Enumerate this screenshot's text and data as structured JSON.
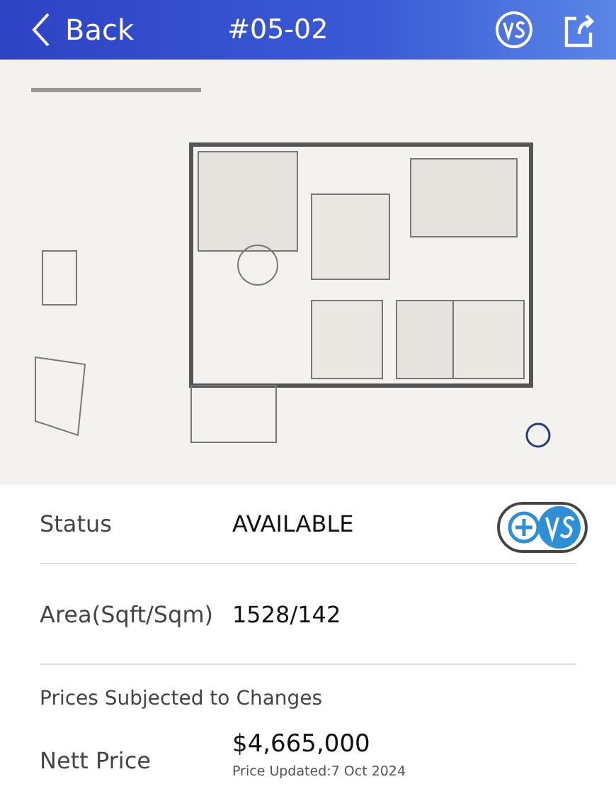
{
  "header": {
    "back": "Back",
    "title": "#05-02"
  },
  "details": [
    {
      "label": "Status",
      "value": "AVAILABLE"
    },
    {
      "label": "Area(Sqft/Sqm)",
      "value": "1528/142"
    }
  ],
  "note": "Prices Subjected to Changes",
  "price": {
    "label": "Nett Price",
    "value": "$4,665,000",
    "updated": "Price Updated:7 Oct 2024"
  }
}
